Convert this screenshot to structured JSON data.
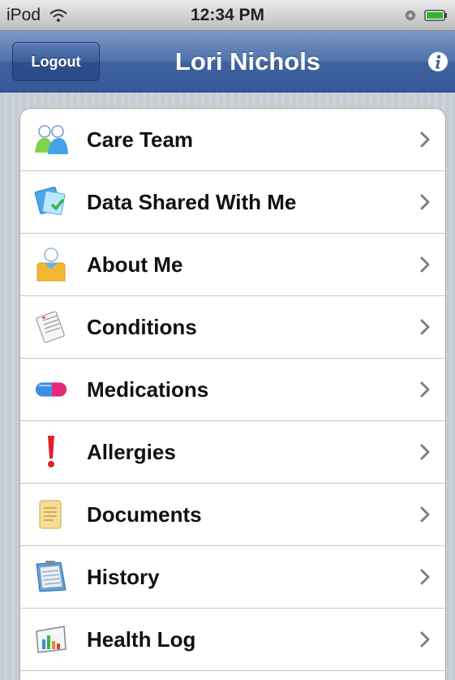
{
  "status_bar": {
    "carrier": "iPod",
    "time": "12:34 PM"
  },
  "nav": {
    "logout_label": "Logout",
    "title": "Lori Nichols"
  },
  "menu": {
    "items": [
      {
        "label": "Care Team",
        "icon": "care-team-icon"
      },
      {
        "label": "Data Shared With Me",
        "icon": "data-shared-icon"
      },
      {
        "label": "About Me",
        "icon": "about-me-icon"
      },
      {
        "label": "Conditions",
        "icon": "conditions-icon"
      },
      {
        "label": "Medications",
        "icon": "medications-icon"
      },
      {
        "label": "Allergies",
        "icon": "allergies-icon"
      },
      {
        "label": "Documents",
        "icon": "documents-icon"
      },
      {
        "label": "History",
        "icon": "history-icon"
      },
      {
        "label": "Health Log",
        "icon": "health-log-icon"
      }
    ]
  },
  "colors": {
    "nav_bar": "#4f72ac",
    "list_background": "#ffffff",
    "page_background": "#c5ccd4"
  }
}
